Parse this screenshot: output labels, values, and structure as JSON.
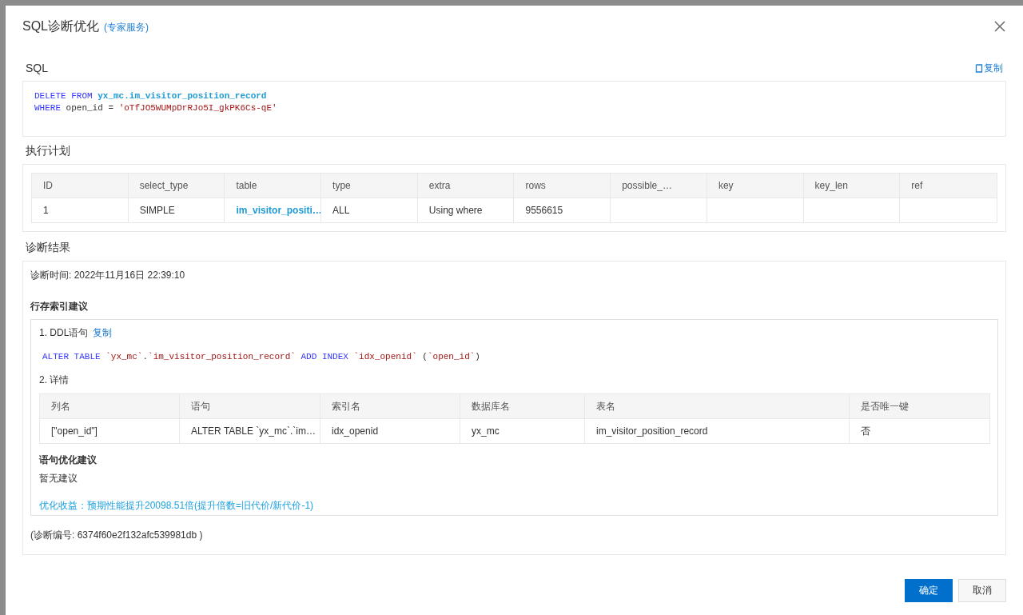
{
  "dialog": {
    "title": "SQL诊断优化",
    "title_link": "(专家服务)"
  },
  "sql_section": {
    "heading": "SQL",
    "copy": "复制",
    "lines": [
      [
        {
          "text": "DELETE FROM ",
          "kind": "keyword"
        },
        {
          "text": "yx_mc.im_visitor_position_record",
          "kind": "identifier"
        }
      ],
      [
        {
          "text": "WHERE ",
          "kind": "keyword"
        },
        {
          "text": "open_id = ",
          "kind": "plain"
        },
        {
          "text": "'oTfJO5WUMpDrRJo5I_gkPK6Cs-qE'",
          "kind": "string"
        }
      ]
    ]
  },
  "plan_section": {
    "heading": "执行计划",
    "columns": [
      "ID",
      "select_type",
      "table",
      "type",
      "extra",
      "rows",
      "possible_…",
      "key",
      "key_len",
      "ref"
    ],
    "rows": [
      [
        {
          "text": "1",
          "kind": "text"
        },
        {
          "text": "SIMPLE",
          "kind": "text"
        },
        {
          "text": "im_visitor_positi…",
          "kind": "link"
        },
        {
          "text": "ALL",
          "kind": "text"
        },
        {
          "text": "Using where",
          "kind": "text"
        },
        {
          "text": "9556615",
          "kind": "text"
        }
      ]
    ]
  },
  "result_section": {
    "heading": "诊断结果",
    "time": "诊断时间: 2022年11月16日 22:39:10",
    "index_heading": "行存索引建议",
    "ddl_label": "1. DDL语句",
    "ddl_copy": "复制",
    "ddl_line": [
      {
        "text": "ALTER TABLE ",
        "kind": "keyword"
      },
      {
        "text": "`yx_mc`",
        "kind": "string"
      },
      {
        "text": ".",
        "kind": "plain"
      },
      {
        "text": "`im_visitor_position_record`",
        "kind": "string"
      },
      {
        "text": " ADD INDEX ",
        "kind": "keyword"
      },
      {
        "text": "`idx_openid`",
        "kind": "string"
      },
      {
        "text": " (",
        "kind": "plain"
      },
      {
        "text": "`open_id`",
        "kind": "string"
      },
      {
        "text": ")",
        "kind": "plain"
      }
    ],
    "detail_label": "2. 详情",
    "detail_columns": [
      "列名",
      "语句",
      "索引名",
      "数据库名",
      "表名",
      "是否唯一键"
    ],
    "detail_rows": [
      [
        {
          "text": "[\"open_id\"]",
          "kind": "text"
        },
        {
          "text": "ALTER TABLE `yx_mc`.`im…",
          "kind": "text"
        },
        {
          "text": "idx_openid",
          "kind": "text"
        },
        {
          "text": "yx_mc",
          "kind": "text"
        },
        {
          "text": "im_visitor_position_record",
          "kind": "text"
        },
        {
          "text": "否",
          "kind": "text"
        }
      ]
    ],
    "stmt_heading": "语句优化建议",
    "stmt_text": "暂无建议",
    "benefit": "优化收益：预期性能提升20098.51倍(提升倍数=旧代价/新代价-1)",
    "diag_id": "(诊断编号: 6374f60e2f132afc539981db )"
  },
  "footer": {
    "buttons": [
      {
        "label": "确定",
        "kind": "primary"
      },
      {
        "label": "取消",
        "kind": "secondary"
      }
    ]
  }
}
